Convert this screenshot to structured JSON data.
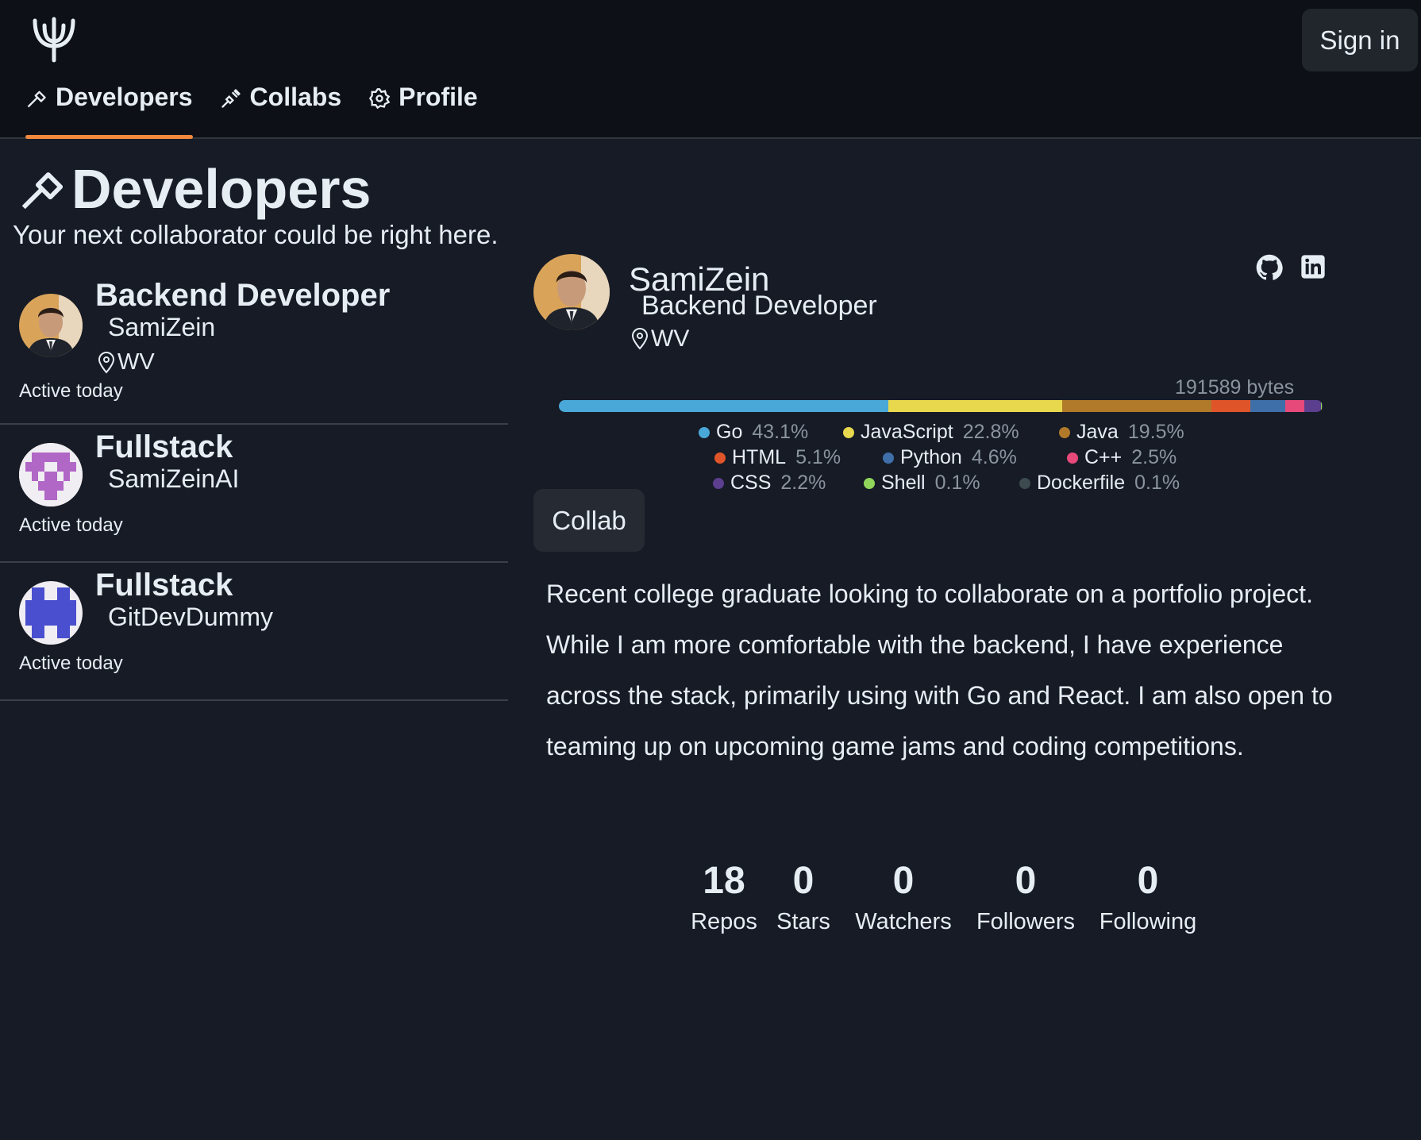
{
  "header": {
    "logo": "trident-icon",
    "sign_in": "Sign in",
    "nav": [
      {
        "label": "Developers",
        "icon": "hammer-icon",
        "active": true
      },
      {
        "label": "Collabs",
        "icon": "plug-icon",
        "active": false
      },
      {
        "label": "Profile",
        "icon": "gear-icon",
        "active": false
      }
    ]
  },
  "page": {
    "title": "Developers",
    "subtitle": "Your next collaborator could be right here."
  },
  "developers": [
    {
      "role": "Backend Developer",
      "username": "SamiZein",
      "location": "WV",
      "activity": "Active today"
    },
    {
      "role": "Fullstack",
      "username": "SamiZeinAI",
      "activity": "Active today"
    },
    {
      "role": "Fullstack",
      "username": "GitDevDummy",
      "activity": "Active today"
    }
  ],
  "profile": {
    "name": "SamiZein",
    "role": "Backend Developer",
    "location": "WV",
    "bytes": "191589 bytes",
    "languages": [
      {
        "name": "Go",
        "pct": "43.1%",
        "value": 43.1,
        "color": "#4aa8d8"
      },
      {
        "name": "JavaScript",
        "pct": "22.8%",
        "value": 22.8,
        "color": "#e8d84e"
      },
      {
        "name": "Java",
        "pct": "19.5%",
        "value": 19.5,
        "color": "#b07a2a"
      },
      {
        "name": "HTML",
        "pct": "5.1%",
        "value": 5.1,
        "color": "#e0542a"
      },
      {
        "name": "Python",
        "pct": "4.6%",
        "value": 4.6,
        "color": "#3f6fa8"
      },
      {
        "name": "C++",
        "pct": "2.5%",
        "value": 2.5,
        "color": "#e6497a"
      },
      {
        "name": "CSS",
        "pct": "2.2%",
        "value": 2.2,
        "color": "#5b3f8e"
      },
      {
        "name": "Shell",
        "pct": "0.1%",
        "value": 0.1,
        "color": "#8fd65a"
      },
      {
        "name": "Dockerfile",
        "pct": "0.1%",
        "value": 0.1,
        "color": "#3d4a4f"
      }
    ],
    "collab_button": "Collab",
    "bio": "Recent college graduate looking to collaborate on a portfolio project. While I am more comfortable with the backend, I have experience across the stack, primarily using with Go and React. I am also open to teaming up on upcoming game jams and coding competitions.",
    "stats": [
      {
        "num": "18",
        "label": "Repos"
      },
      {
        "num": "0",
        "label": "Stars"
      },
      {
        "num": "0",
        "label": "Watchers"
      },
      {
        "num": "0",
        "label": "Followers"
      },
      {
        "num": "0",
        "label": "Following"
      }
    ]
  }
}
